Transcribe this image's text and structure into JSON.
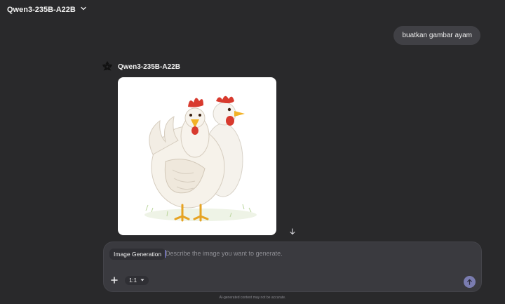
{
  "header": {
    "model_name": "Qwen3-235B-A22B",
    "dropdown_icon": "chevron-down-icon"
  },
  "conversation": {
    "user_message": "buatkan gambar ayam",
    "assistant": {
      "name": "Qwen3-235B-A22B",
      "logo_icon": "qwen-logo-icon",
      "image_subject": "two-white-chickens",
      "download_icon": "arrow-down-icon"
    }
  },
  "composer": {
    "mode_label": "Image Generation",
    "placeholder": "Describe the image you want to generate.",
    "value": "",
    "plus_icon": "plus-icon",
    "aspect_ratio": "1:1",
    "aspect_icon": "caret-down-icon",
    "send_icon": "arrow-up-icon"
  },
  "footer": {
    "disclaimer": "AI-generated content may not be accurate."
  },
  "colors": {
    "background": "#29292b",
    "bubble": "#404045",
    "composer": "#3a3a3f",
    "send_button": "#7a7cb0",
    "cursor": "#8a8cff"
  }
}
